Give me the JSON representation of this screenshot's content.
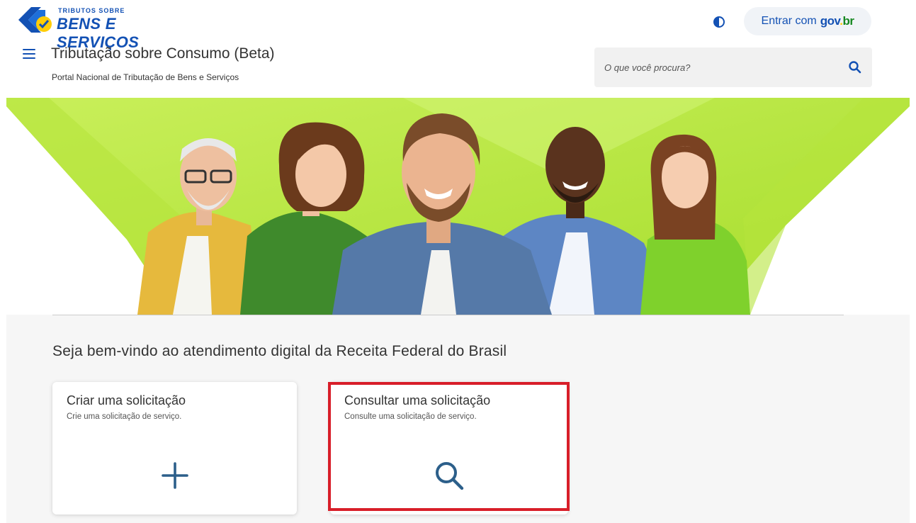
{
  "header": {
    "logo": {
      "small_text": "TRIBUTOS SOBRE",
      "big_text": "BENS E SERVIÇOS"
    },
    "contrast_icon": "contrast-icon",
    "login": {
      "label": "Entrar com",
      "brand_gov": "gov",
      "brand_dot": ".",
      "brand_br": "br"
    },
    "menu_icon": "hamburger-menu-icon",
    "title": "Tributação sobre Consumo (Beta)",
    "subtitle": "Portal Nacional de Tributação de Bens e Serviços",
    "search": {
      "placeholder": "O que você procura?",
      "icon": "search-icon"
    }
  },
  "main": {
    "welcome_heading": "Seja bem-vindo ao atendimento digital da Receita Federal do Brasil",
    "cards": [
      {
        "title": "Criar uma solicitação",
        "description": "Crie uma solicitação de serviço.",
        "icon": "plus-icon"
      },
      {
        "title": "Consultar uma solicitação",
        "description": "Consulte uma solicitação de serviço.",
        "icon": "search-icon"
      }
    ]
  },
  "colors": {
    "primary_blue": "#1351b4",
    "icon_blue": "#2c5f8a",
    "banner_green": "#b8e646",
    "highlight_red": "#d81e29",
    "section_bg": "#f6f6f6"
  }
}
